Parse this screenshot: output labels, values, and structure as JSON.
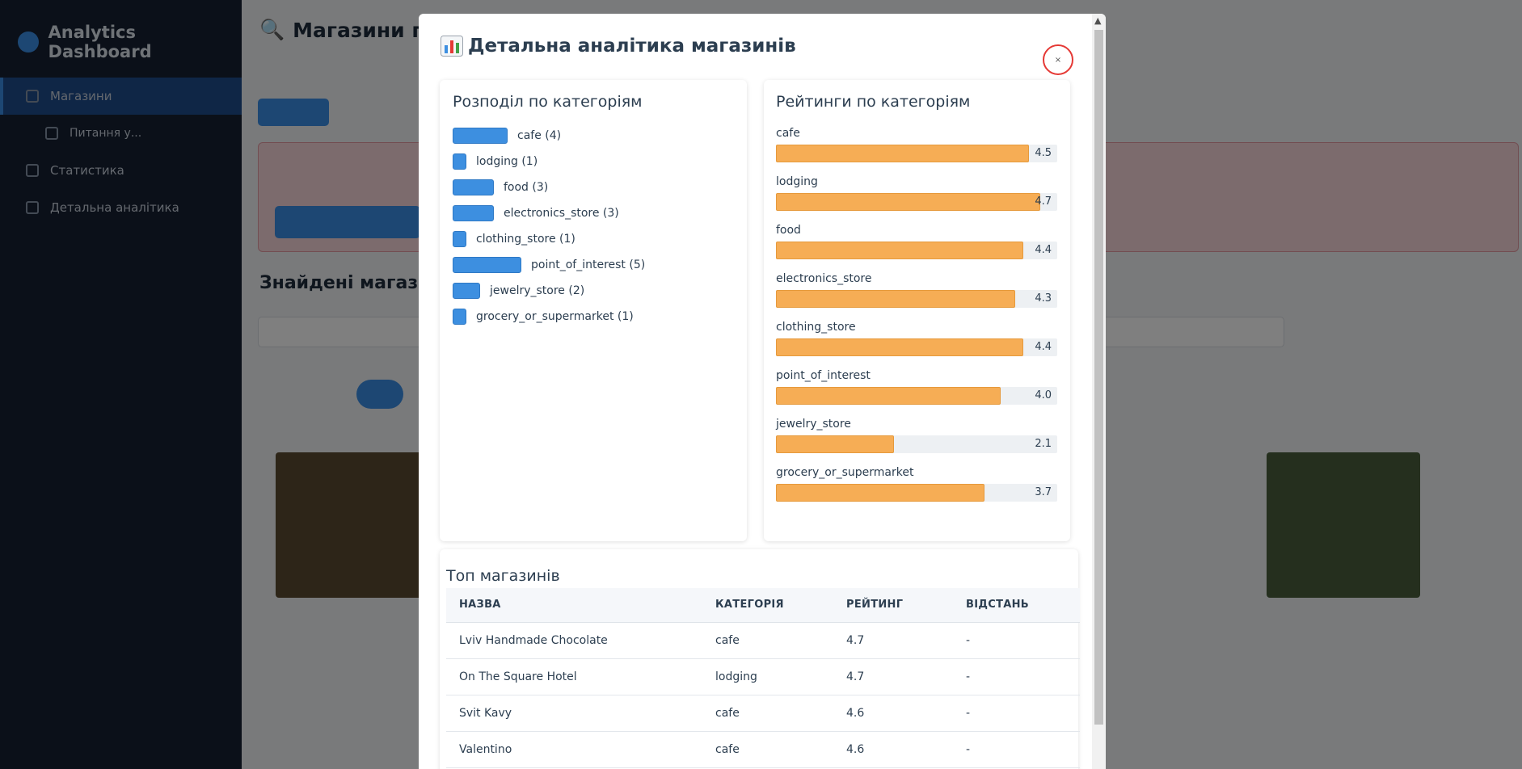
{
  "app": {
    "brand": "Analytics Dashboard",
    "nav": [
      {
        "label": "Магазини",
        "active": true
      },
      {
        "label": "Питання у...",
        "sub": true
      },
      {
        "label": "Статистика"
      },
      {
        "label": "Детальна аналітика"
      }
    ],
    "page_title": "Магазини по...",
    "section_title": "Знайдені магазини"
  },
  "modal": {
    "title": "Детальна аналітика магазинів",
    "close_label": "×",
    "distribution": {
      "title": "Розподіл по категоріям",
      "items": [
        {
          "name": "cafe",
          "count": 4,
          "label": "cafe (4)"
        },
        {
          "name": "lodging",
          "count": 1,
          "label": "lodging (1)"
        },
        {
          "name": "food",
          "count": 3,
          "label": "food (3)"
        },
        {
          "name": "electronics_store",
          "count": 3,
          "label": "electronics_store (3)"
        },
        {
          "name": "clothing_store",
          "count": 1,
          "label": "clothing_store (1)"
        },
        {
          "name": "point_of_interest",
          "count": 5,
          "label": "point_of_interest (5)"
        },
        {
          "name": "jewelry_store",
          "count": 2,
          "label": "jewelry_store (2)"
        },
        {
          "name": "grocery_or_supermarket",
          "count": 1,
          "label": "grocery_or_supermarket (1)"
        }
      ]
    },
    "ratings": {
      "title": "Рейтинги по категоріям",
      "max": 5,
      "items": [
        {
          "name": "cafe",
          "value": "4.5",
          "fraction": 0.9
        },
        {
          "name": "lodging",
          "value": "4.7",
          "fraction": 0.94
        },
        {
          "name": "food",
          "value": "4.4",
          "fraction": 0.88
        },
        {
          "name": "electronics_store",
          "value": "4.3",
          "fraction": 0.85
        },
        {
          "name": "clothing_store",
          "value": "4.4",
          "fraction": 0.88
        },
        {
          "name": "point_of_interest",
          "value": "4.0",
          "fraction": 0.8
        },
        {
          "name": "jewelry_store",
          "value": "2.1",
          "fraction": 0.42
        },
        {
          "name": "grocery_or_supermarket",
          "value": "3.7",
          "fraction": 0.74
        }
      ]
    },
    "top": {
      "title": "Топ магазинів",
      "columns": [
        "НАЗВА",
        "КАТЕГОРІЯ",
        "РЕЙТИНГ",
        "ВІДСТАНЬ"
      ],
      "rows": [
        [
          "Lviv Handmade Chocolate",
          "cafe",
          "4.7",
          "-"
        ],
        [
          "On The Square Hotel",
          "lodging",
          "4.7",
          "-"
        ],
        [
          "Svit Kavy",
          "cafe",
          "4.6",
          "-"
        ],
        [
          "Valentino",
          "cafe",
          "4.6",
          "-"
        ]
      ]
    }
  },
  "colors": {
    "bar_blue": "#3d8fe0",
    "bar_orange": "#f6ad55",
    "close_ring": "#e53935"
  }
}
